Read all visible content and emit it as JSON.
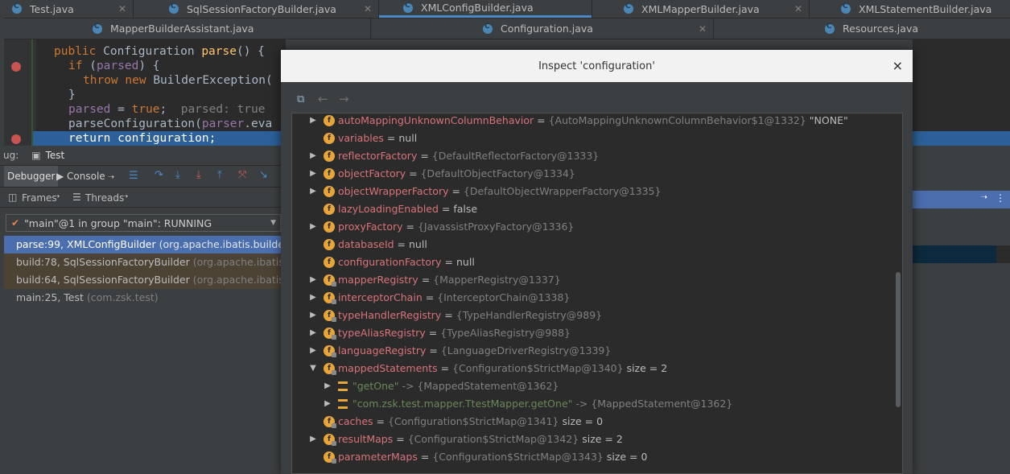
{
  "tabs_row1": [
    {
      "label": "Test.java"
    },
    {
      "label": "SqlSessionFactoryBuilder.java"
    },
    {
      "label": "XMLConfigBuilder.java"
    },
    {
      "label": "XMLMapperBuilder.java"
    },
    {
      "label": "XMLStatementBuilder.java"
    }
  ],
  "tabs_row2": [
    {
      "label": "MapperBuilderAssistant.java"
    },
    {
      "label": "Configuration.java"
    },
    {
      "label": "Resources.java"
    }
  ],
  "code": {
    "l1_kw": "public ",
    "l1_type": "Configuration ",
    "l1_fn": "parse",
    "l1_rest": "() {",
    "l2_kw": "if ",
    "l2_rest": "(",
    "l2_fld": "parsed",
    "l2_end": ") {",
    "l3_kw": "throw new ",
    "l3_rest": "BuilderException(",
    "l4": "}",
    "l5_fld": "parsed",
    "l5_eq": " = ",
    "l5_kw": "true",
    "l5_semi": ";",
    "l5_cmt": "  parsed: true",
    "l6_a": "parseConfiguration(",
    "l6_fld": "parser",
    "l6_b": ".eva",
    "l7_kw": "return ",
    "l7_rest": "configuration;"
  },
  "debug": {
    "prefix": "ug:",
    "run_tab": "Test",
    "debugger_tab": "Debugger",
    "console_tab": "Console",
    "frames_label": "Frames",
    "threads_label": "Threads",
    "thread_selected": "\"main\"@1 in group \"main\": RUNNING",
    "frames": [
      {
        "method": "parse:99, XMLConfigBuilder",
        "pkg": " (org.apache.ibatis.builder.xml)"
      },
      {
        "method": "build:78, SqlSessionFactoryBuilder",
        "pkg": " (org.apache.ibatis.sessi"
      },
      {
        "method": "build:64, SqlSessionFactoryBuilder",
        "pkg": " (org.apache.ibatis.sessi"
      },
      {
        "method": "main:25, Test",
        "pkg": " (com.zsk.test)"
      }
    ]
  },
  "dialog": {
    "title": "Inspect 'configuration'",
    "close": "×",
    "back": "←",
    "forward": "→",
    "rows": [
      {
        "name": "autoMappingUnknownColumnBehavior",
        "ref": "{AutoMappingUnknownColumnBehavior$1@1332}",
        "val": " \"NONE\"",
        "expand": "▶",
        "icon": "f"
      },
      {
        "name": "variables",
        "ref": "",
        "val": "null",
        "expand": "",
        "icon": "f"
      },
      {
        "name": "reflectorFactory",
        "ref": "{DefaultReflectorFactory@1333}",
        "val": "",
        "expand": "▶",
        "icon": "f"
      },
      {
        "name": "objectFactory",
        "ref": "{DefaultObjectFactory@1334}",
        "val": "",
        "expand": "▶",
        "icon": "f"
      },
      {
        "name": "objectWrapperFactory",
        "ref": "{DefaultObjectWrapperFactory@1335}",
        "val": "",
        "expand": "▶",
        "icon": "f"
      },
      {
        "name": "lazyLoadingEnabled",
        "ref": "",
        "val": "false",
        "expand": "",
        "icon": "f"
      },
      {
        "name": "proxyFactory",
        "ref": "{JavassistProxyFactory@1336}",
        "val": "",
        "expand": "▶",
        "icon": "f"
      },
      {
        "name": "databaseId",
        "ref": "",
        "val": "null",
        "expand": "",
        "icon": "f"
      },
      {
        "name": "configurationFactory",
        "ref": "",
        "val": "null",
        "expand": "",
        "icon": "f"
      },
      {
        "name": "mapperRegistry",
        "ref": "{MapperRegistry@1337}",
        "val": "",
        "expand": "▶",
        "icon": "fl"
      },
      {
        "name": "interceptorChain",
        "ref": "{InterceptorChain@1338}",
        "val": "",
        "expand": "▶",
        "icon": "fl"
      },
      {
        "name": "typeHandlerRegistry",
        "ref": "{TypeHandlerRegistry@989}",
        "val": "",
        "expand": "▶",
        "icon": "fl"
      },
      {
        "name": "typeAliasRegistry",
        "ref": "{TypeAliasRegistry@988}",
        "val": "",
        "expand": "▶",
        "icon": "fl"
      },
      {
        "name": "languageRegistry",
        "ref": "{LanguageDriverRegistry@1339}",
        "val": "",
        "expand": "▶",
        "icon": "fl"
      },
      {
        "name": "mappedStatements",
        "ref": "{Configuration$StrictMap@1340}",
        "val": "  size = 2",
        "expand": "▼",
        "icon": "fl"
      },
      {
        "name": "\"getOne\"",
        "ref": "-> {MappedStatement@1362}",
        "val": "",
        "expand": "▶",
        "icon": "e",
        "child": true
      },
      {
        "name": "\"com.zsk.test.mapper.TtestMapper.getOne\"",
        "ref": "-> {MappedStatement@1362}",
        "val": "",
        "expand": "▶",
        "icon": "e",
        "child": true
      },
      {
        "name": "caches",
        "ref": "{Configuration$StrictMap@1341}",
        "val": "  size = 0",
        "expand": "",
        "icon": "fl"
      },
      {
        "name": "resultMaps",
        "ref": "{Configuration$StrictMap@1342}",
        "val": "  size = 2",
        "expand": "▶",
        "icon": "fl"
      },
      {
        "name": "parameterMaps",
        "ref": "{Configuration$StrictMap@1343}",
        "val": "  size = 0",
        "expand": "",
        "icon": "fl"
      }
    ]
  },
  "colors": {
    "accent": "#4a88c7",
    "selection": "#4b6eaf",
    "field_name": "#d8737a",
    "string": "#6a8759",
    "icon_field": "#e7a53a"
  }
}
